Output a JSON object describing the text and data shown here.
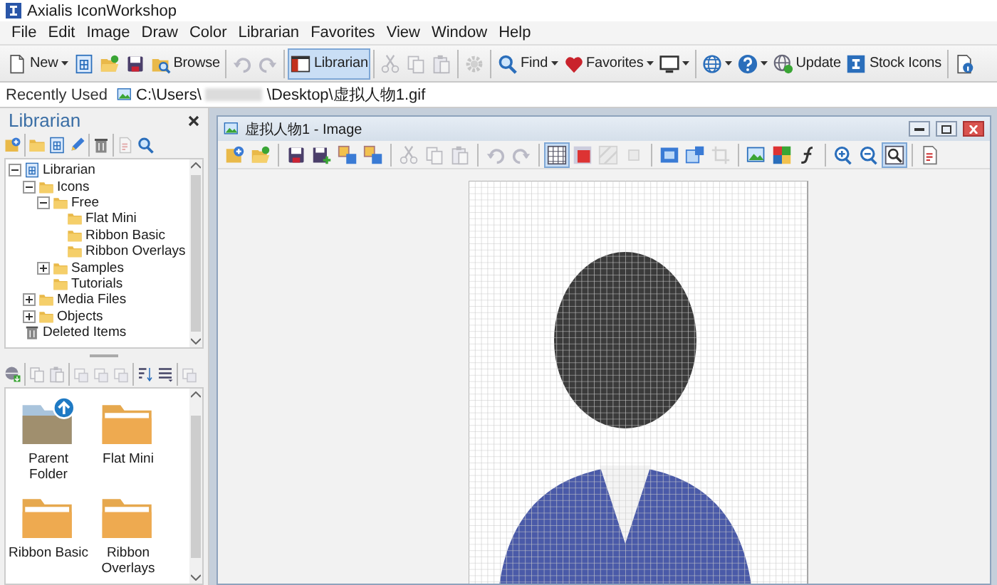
{
  "app": {
    "title": "Axialis IconWorkshop"
  },
  "menu": [
    "File",
    "Edit",
    "Image",
    "Draw",
    "Color",
    "Librarian",
    "Favorites",
    "View",
    "Window",
    "Help"
  ],
  "toolbar": {
    "items": [
      {
        "kind": "button",
        "label": "New",
        "dropdown": true,
        "selected": false,
        "disabled": false
      },
      {
        "kind": "icon",
        "dropdown": false,
        "selected": false,
        "disabled": false
      },
      {
        "kind": "icon",
        "dropdown": false,
        "selected": false,
        "disabled": false
      },
      {
        "kind": "icon",
        "dropdown": false,
        "selected": false,
        "disabled": false
      },
      {
        "kind": "button",
        "label": "Browse",
        "dropdown": false,
        "selected": false,
        "disabled": false
      },
      {
        "kind": "separator"
      },
      {
        "kind": "icon",
        "dropdown": false,
        "selected": false,
        "disabled": true
      },
      {
        "kind": "icon",
        "dropdown": false,
        "selected": false,
        "disabled": true
      },
      {
        "kind": "separator"
      },
      {
        "kind": "button",
        "label": "Librarian",
        "dropdown": false,
        "selected": true,
        "disabled": false
      },
      {
        "kind": "separator"
      },
      {
        "kind": "icon",
        "dropdown": false,
        "selected": false,
        "disabled": true
      },
      {
        "kind": "icon",
        "dropdown": false,
        "selected": false,
        "disabled": true
      },
      {
        "kind": "icon",
        "dropdown": false,
        "selected": false,
        "disabled": true
      },
      {
        "kind": "separator"
      },
      {
        "kind": "icon",
        "dropdown": false,
        "selected": false,
        "disabled": true
      },
      {
        "kind": "separator"
      },
      {
        "kind": "button",
        "label": "Find",
        "dropdown": true,
        "selected": false,
        "disabled": false
      },
      {
        "kind": "button",
        "label": "Favorites",
        "dropdown": true,
        "selected": false,
        "disabled": false
      },
      {
        "kind": "icon",
        "dropdown": true,
        "selected": false,
        "disabled": false
      },
      {
        "kind": "separator"
      },
      {
        "kind": "icon",
        "dropdown": true,
        "selected": false,
        "disabled": false
      },
      {
        "kind": "icon",
        "dropdown": true,
        "selected": false,
        "disabled": false
      },
      {
        "kind": "button",
        "label": "Update",
        "dropdown": false,
        "selected": false,
        "disabled": false
      },
      {
        "kind": "button",
        "label": "Stock Icons",
        "dropdown": false,
        "selected": false,
        "disabled": false
      },
      {
        "kind": "separator"
      },
      {
        "kind": "icon",
        "dropdown": false,
        "selected": false,
        "disabled": false
      }
    ]
  },
  "recent": {
    "label": "Recently Used",
    "path_start": "C:\\Users\\",
    "path_end": "\\Desktop\\虚拟人物1.gif"
  },
  "librarian": {
    "title": "Librarian",
    "toolbar": [
      {
        "kind": "icon",
        "disabled": false
      },
      {
        "kind": "separator"
      },
      {
        "kind": "icon",
        "disabled": false
      },
      {
        "kind": "icon",
        "disabled": false
      },
      {
        "kind": "icon",
        "disabled": false
      },
      {
        "kind": "separator"
      },
      {
        "kind": "icon",
        "disabled": false
      },
      {
        "kind": "separator"
      },
      {
        "kind": "icon",
        "disabled": true
      },
      {
        "kind": "icon",
        "disabled": false
      }
    ],
    "tree": [
      {
        "label": "Librarian",
        "expanded": true,
        "children": [
          {
            "label": "Icons",
            "expanded": true,
            "children": [
              {
                "label": "Free",
                "expanded": true,
                "children": [
                  {
                    "label": "Flat Mini"
                  },
                  {
                    "label": "Ribbon Basic"
                  },
                  {
                    "label": "Ribbon Overlays"
                  }
                ]
              },
              {
                "label": "Samples",
                "expanded": false
              },
              {
                "label": "Tutorials"
              }
            ]
          },
          {
            "label": "Media Files",
            "expanded": false
          },
          {
            "label": "Objects",
            "expanded": false
          }
        ]
      },
      {
        "label": "Deleted Items"
      }
    ],
    "lower_toolbar": [
      {
        "kind": "icon",
        "disabled": false
      },
      {
        "kind": "separator"
      },
      {
        "kind": "icon",
        "disabled": true
      },
      {
        "kind": "icon",
        "disabled": true
      },
      {
        "kind": "separator"
      },
      {
        "kind": "icon",
        "disabled": true
      },
      {
        "kind": "icon",
        "disabled": true
      },
      {
        "kind": "icon",
        "disabled": true
      },
      {
        "kind": "separator"
      },
      {
        "kind": "icon",
        "disabled": false
      },
      {
        "kind": "icon",
        "disabled": false
      },
      {
        "kind": "separator"
      },
      {
        "kind": "icon",
        "disabled": true
      }
    ],
    "items": [
      {
        "kind": "parent",
        "label": "Parent Folder"
      },
      {
        "kind": "folder",
        "label": "Flat Mini"
      },
      {
        "kind": "folder",
        "label": "Ribbon Basic"
      },
      {
        "kind": "folder",
        "label": "Ribbon Overlays"
      }
    ]
  },
  "document": {
    "title": "虚拟人物1 - Image",
    "toolbar": [
      {
        "kind": "icon",
        "disabled": false,
        "selected": false
      },
      {
        "kind": "icon",
        "disabled": false,
        "selected": false
      },
      {
        "kind": "separator"
      },
      {
        "kind": "icon",
        "disabled": false,
        "selected": false
      },
      {
        "kind": "icon",
        "disabled": false,
        "selected": false
      },
      {
        "kind": "icon",
        "disabled": false,
        "selected": false
      },
      {
        "kind": "icon",
        "disabled": false,
        "selected": false
      },
      {
        "kind": "separator"
      },
      {
        "kind": "icon",
        "disabled": true,
        "selected": false
      },
      {
        "kind": "icon",
        "disabled": true,
        "selected": false
      },
      {
        "kind": "icon",
        "disabled": true,
        "selected": false
      },
      {
        "kind": "separator"
      },
      {
        "kind": "icon",
        "disabled": true,
        "selected": false
      },
      {
        "kind": "icon",
        "disabled": true,
        "selected": false
      },
      {
        "kind": "separator"
      },
      {
        "kind": "icon",
        "disabled": false,
        "selected": true
      },
      {
        "kind": "icon",
        "disabled": false,
        "selected": false
      },
      {
        "kind": "icon",
        "disabled": true,
        "selected": false
      },
      {
        "kind": "icon",
        "disabled": true,
        "selected": false
      },
      {
        "kind": "separator"
      },
      {
        "kind": "icon",
        "disabled": false,
        "selected": false
      },
      {
        "kind": "icon",
        "disabled": false,
        "selected": false
      },
      {
        "kind": "icon",
        "disabled": true,
        "selected": false
      },
      {
        "kind": "separator"
      },
      {
        "kind": "icon",
        "disabled": false,
        "selected": false
      },
      {
        "kind": "icon",
        "disabled": false,
        "selected": false
      },
      {
        "kind": "icon",
        "disabled": false,
        "selected": false
      },
      {
        "kind": "separator"
      },
      {
        "kind": "icon",
        "disabled": false,
        "selected": false
      },
      {
        "kind": "icon",
        "disabled": false,
        "selected": false
      },
      {
        "kind": "icon",
        "disabled": false,
        "selected": true
      },
      {
        "kind": "separator"
      },
      {
        "kind": "icon",
        "disabled": false,
        "selected": false
      }
    ]
  }
}
